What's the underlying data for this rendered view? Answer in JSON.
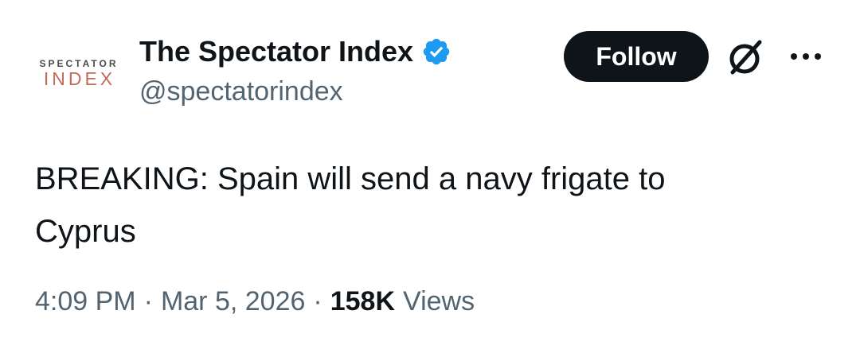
{
  "author": {
    "avatar_top_text": "SPECTATOR",
    "avatar_bottom_text": "INDEX",
    "display_name": "The Spectator Index",
    "handle": "@spectatorindex",
    "verified_icon": "verified-badge-icon",
    "verified_color": "#1d9bf0"
  },
  "actions": {
    "follow_label": "Follow",
    "grok_icon": "grok-icon",
    "more_icon": "more-options-icon"
  },
  "tweet": {
    "text_line1": "BREAKING: Spain will send a navy frigate to",
    "text_line2": "Cyprus"
  },
  "meta": {
    "time": "4:09 PM",
    "separator": "·",
    "date": "Mar 5, 2026",
    "views_count": "158K",
    "views_label": "Views"
  }
}
